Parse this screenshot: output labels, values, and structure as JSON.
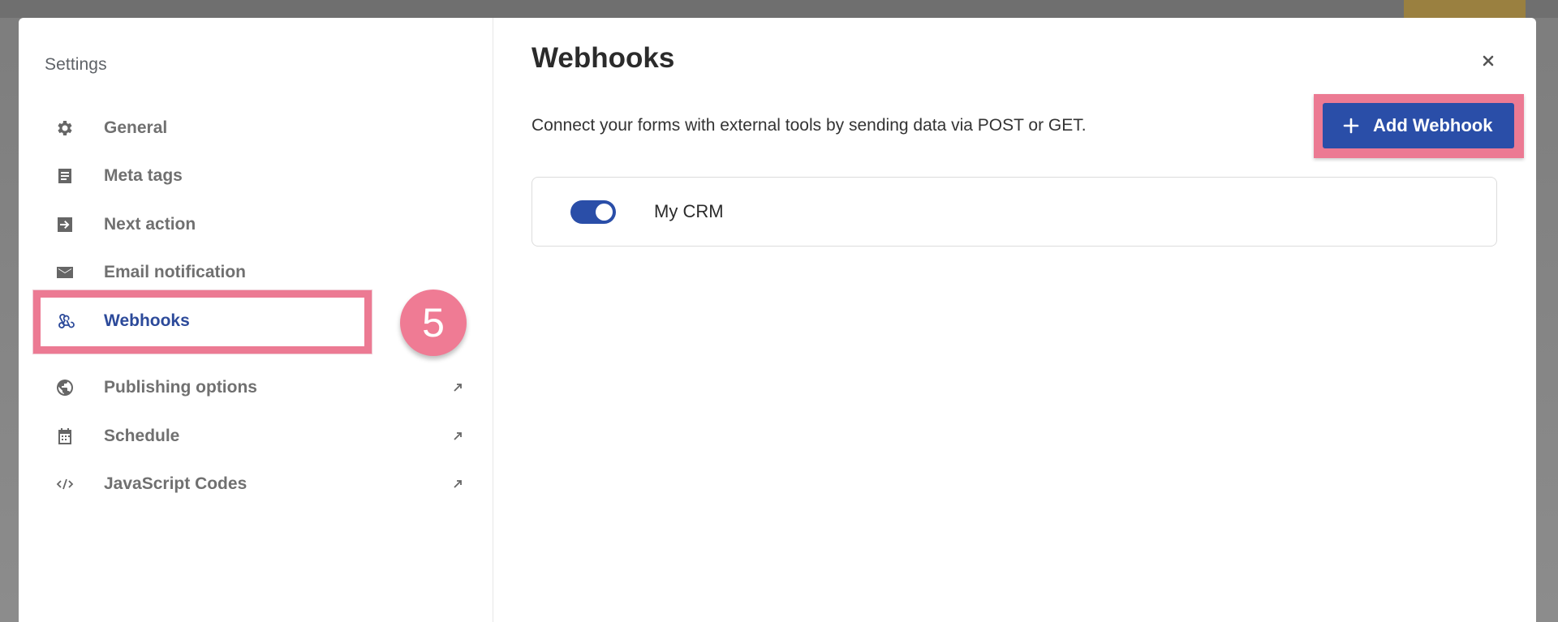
{
  "sidebar": {
    "title": "Settings",
    "items": [
      {
        "label": "General",
        "icon": "gear-icon"
      },
      {
        "label": "Meta tags",
        "icon": "document-icon"
      },
      {
        "label": "Next action",
        "icon": "arrow-right-box-icon"
      },
      {
        "label": "Email notification",
        "icon": "envelope-icon"
      },
      {
        "label": "Webhooks",
        "icon": "webhook-icon",
        "active": true
      }
    ],
    "external_items": [
      {
        "label": "Publishing options",
        "icon": "globe-icon"
      },
      {
        "label": "Schedule",
        "icon": "calendar-icon"
      },
      {
        "label": "JavaScript Codes",
        "icon": "code-icon"
      }
    ]
  },
  "annotation": {
    "step_number": "5",
    "highlight_color": "#ec7a93"
  },
  "main": {
    "title": "Webhooks",
    "description": "Connect your forms with external tools by sending data via POST or GET.",
    "add_button_label": "Add Webhook",
    "webhooks": [
      {
        "name": "My CRM",
        "enabled": true
      }
    ]
  },
  "colors": {
    "accent": "#2a4ea8",
    "active_nav": "#2c4a9a",
    "annotation": "#ec7a93"
  }
}
